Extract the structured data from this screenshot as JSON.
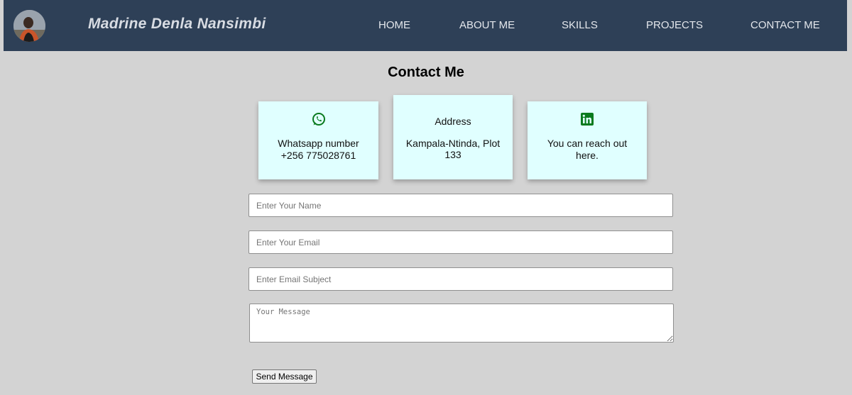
{
  "header": {
    "name": "Madrine Denla Nansimbi",
    "nav": [
      {
        "label": "HOME"
      },
      {
        "label": "ABOUT ME"
      },
      {
        "label": "SKILLS"
      },
      {
        "label": "PROJECTS"
      },
      {
        "label": "CONTACT ME"
      }
    ]
  },
  "contact": {
    "title": "Contact Me",
    "cards": [
      {
        "icon": "whatsapp-icon",
        "lines": [
          "Whatsapp number",
          "+256 775028761"
        ]
      },
      {
        "heading": "Address",
        "lines": [
          "Kampala-Ntinda, Plot",
          "133"
        ]
      },
      {
        "icon": "linkedin-icon",
        "lines": [
          "You can reach out",
          "here."
        ]
      }
    ]
  },
  "form": {
    "name_placeholder": "Enter Your Name",
    "email_placeholder": "Enter Your Email",
    "subject_placeholder": "Enter Email Subject",
    "message_placeholder": "Your Message",
    "send_label": "Send Message"
  },
  "colors": {
    "navbar": "#2e4057",
    "page_background": "#d3d3d3",
    "card_background": "#e0ffff",
    "icon_green": "#0a7a1e"
  }
}
